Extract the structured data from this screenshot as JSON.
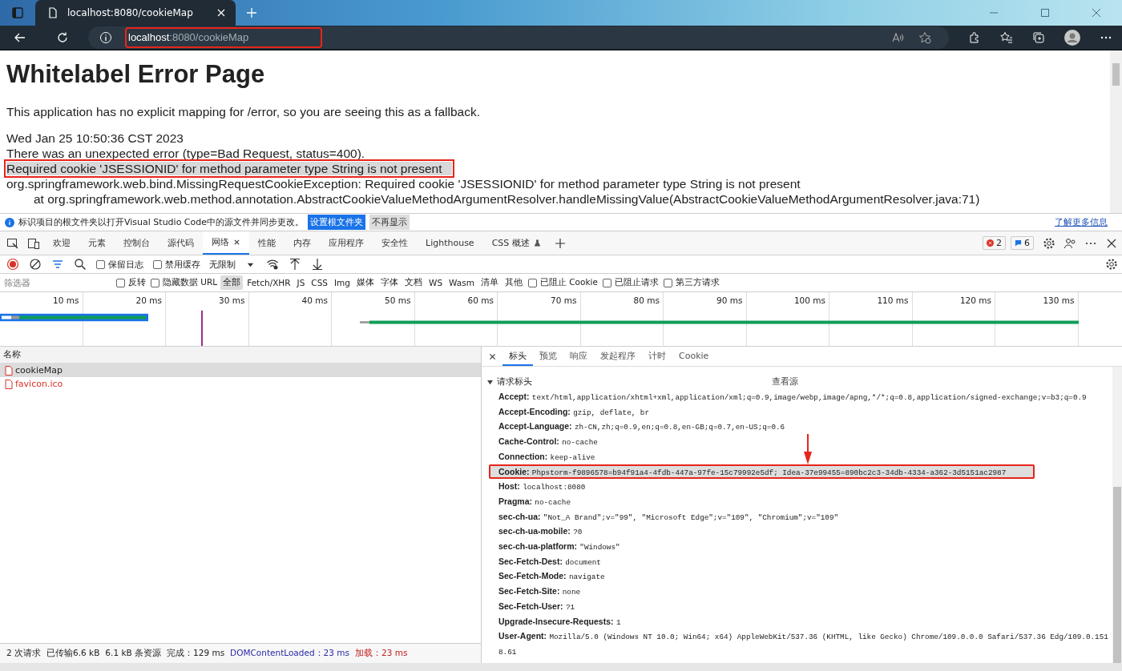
{
  "browser": {
    "tab_title": "localhost:8080/cookieMap",
    "address": {
      "host": "localhost",
      "path": ":8080/cookieMap",
      "highlighted": true
    }
  },
  "page": {
    "title": "Whitelabel Error Page",
    "intro": "This application has no explicit mapping for /error, so you are seeing this as a fallback.",
    "timestamp": "Wed Jan 25 10:50:36 CST 2023",
    "error": "There was an unexpected error (type=Bad Request, status=400).",
    "message": {
      "text": "Required cookie 'JSESSIONID' for method parameter type String is not present",
      "highlighted": true
    },
    "exception": "org.springframework.web.bind.MissingRequestCookieException: Required cookie 'JSESSIONID' for method parameter type String is not present",
    "trace": "at org.springframework.web.method.annotation.AbstractCookieValueMethodArgumentResolver.handleMissingValue(AbstractCookieValueMethodArgumentResolver.java:71)"
  },
  "infobar": {
    "text": "标识项目的根文件夹以打开Visual Studio Code中的源文件并同步更改。",
    "primary_button": "设置根文件夹",
    "secondary_button": "不再显示",
    "link": "了解更多信息"
  },
  "devtools": {
    "tabs": [
      {
        "label": "欢迎",
        "selected": false,
        "kind": "plain"
      },
      {
        "label": "元素",
        "selected": false,
        "kind": "plain"
      },
      {
        "label": "控制台",
        "selected": false,
        "kind": "plain"
      },
      {
        "label": "源代码",
        "selected": false,
        "kind": "plain"
      },
      {
        "label": "网络",
        "selected": true,
        "kind": "plain"
      },
      {
        "label": "性能",
        "selected": false,
        "kind": "plain"
      },
      {
        "label": "内存",
        "selected": false,
        "kind": "plain"
      },
      {
        "label": "应用程序",
        "selected": false,
        "kind": "plain"
      },
      {
        "label": "安全性",
        "selected": false,
        "kind": "plain"
      },
      {
        "label": "Lighthouse",
        "selected": false,
        "kind": "plain"
      },
      {
        "label": "CSS 概述",
        "selected": false,
        "kind": "experiment"
      }
    ],
    "error_count": "2",
    "message_count": "6",
    "toolbar": {
      "preserve_log": {
        "label": "保留日志",
        "checked": false
      },
      "disable_cache": {
        "label": "禁用缓存",
        "checked": false
      },
      "throttle": "无限制"
    },
    "filter": {
      "placeholder": "筛选器",
      "invert": {
        "label": "反转",
        "checked": false
      },
      "hide_data": {
        "label": "隐藏数据 URL",
        "checked": false
      },
      "types": [
        {
          "label": "全部",
          "selected": true
        },
        {
          "label": "Fetch/XHR",
          "selected": false
        },
        {
          "label": "JS",
          "selected": false
        },
        {
          "label": "CSS",
          "selected": false
        },
        {
          "label": "Img",
          "selected": false
        },
        {
          "label": "媒体",
          "selected": false
        },
        {
          "label": "字体",
          "selected": false
        },
        {
          "label": "文档",
          "selected": false
        },
        {
          "label": "WS",
          "selected": false
        },
        {
          "label": "Wasm",
          "selected": false
        },
        {
          "label": "清单",
          "selected": false
        },
        {
          "label": "其他",
          "selected": false
        }
      ],
      "options": [
        {
          "label": "已阻止 Cookie",
          "checked": false
        },
        {
          "label": "已阻止请求",
          "checked": false
        },
        {
          "label": "第三方请求",
          "checked": false
        }
      ]
    },
    "timeline": {
      "ticks": [
        "10 ms",
        "20 ms",
        "30 ms",
        "40 ms",
        "50 ms",
        "60 ms",
        "70 ms",
        "80 ms",
        "90 ms",
        "100 ms",
        "110 ms",
        "120 ms",
        "130 ms"
      ]
    },
    "requests": {
      "column": "名称",
      "rows": [
        {
          "name": "cookieMap",
          "selected": true
        },
        {
          "name": "favicon.ico",
          "selected": false
        }
      ]
    },
    "status": [
      {
        "text": "2 次请求",
        "kind": "plain"
      },
      {
        "text": "已传输6.6 kB",
        "kind": "plain"
      },
      {
        "text": "6.1 kB 条资源",
        "kind": "plain"
      },
      {
        "text": "完成：129 ms",
        "kind": "plain"
      },
      {
        "text": "DOMContentLoaded：23 ms",
        "kind": "dcl"
      },
      {
        "text": "加载：23 ms",
        "kind": "load"
      }
    ],
    "detail": {
      "tabs": [
        {
          "label": "标头",
          "selected": true
        },
        {
          "label": "预览",
          "selected": false
        },
        {
          "label": "响应",
          "selected": false
        },
        {
          "label": "发起程序",
          "selected": false
        },
        {
          "label": "计时",
          "selected": false
        },
        {
          "label": "Cookie",
          "selected": false
        }
      ],
      "section": {
        "title": "请求标头",
        "expanded": true,
        "action": "查看源"
      },
      "headers": [
        {
          "name": "Accept:",
          "value": "text/html,application/xhtml+xml,application/xml;q=0.9,image/webp,image/apng,*/*;q=0.8,application/signed-exchange;v=b3;q=0.9",
          "highlighted": false
        },
        {
          "name": "Accept-Encoding:",
          "value": "gzip, deflate, br",
          "highlighted": false
        },
        {
          "name": "Accept-Language:",
          "value": "zh-CN,zh;q=0.9,en;q=0.8,en-GB;q=0.7,en-US;q=0.6",
          "highlighted": false
        },
        {
          "name": "Cache-Control:",
          "value": "no-cache",
          "highlighted": false
        },
        {
          "name": "Connection:",
          "value": "keep-alive",
          "highlighted": false
        },
        {
          "name": "Cookie:",
          "value": "Phpstorm-f9896578=b94f91a4-4fdb-447a-97fe-15c79992e5df; Idea-37e99455=890bc2c3-34db-4334-a362-3d5151ac2987",
          "highlighted": true
        },
        {
          "name": "Host:",
          "value": "localhost:8080",
          "highlighted": false
        },
        {
          "name": "Pragma:",
          "value": "no-cache",
          "highlighted": false
        },
        {
          "name": "sec-ch-ua:",
          "value": "\"Not_A Brand\";v=\"99\", \"Microsoft Edge\";v=\"109\", \"Chromium\";v=\"109\"",
          "highlighted": false
        },
        {
          "name": "sec-ch-ua-mobile:",
          "value": "?0",
          "highlighted": false
        },
        {
          "name": "sec-ch-ua-platform:",
          "value": "\"Windows\"",
          "highlighted": false
        },
        {
          "name": "Sec-Fetch-Dest:",
          "value": "document",
          "highlighted": false
        },
        {
          "name": "Sec-Fetch-Mode:",
          "value": "navigate",
          "highlighted": false
        },
        {
          "name": "Sec-Fetch-Site:",
          "value": "none",
          "highlighted": false
        },
        {
          "name": "Sec-Fetch-User:",
          "value": "?1",
          "highlighted": false
        },
        {
          "name": "Upgrade-Insecure-Requests:",
          "value": "1",
          "highlighted": false
        },
        {
          "name": "User-Agent:",
          "value": "Mozilla/5.0 (Windows NT 10.0; Win64; x64) AppleWebKit/537.36 (KHTML, like Gecko) Chrome/109.0.0.0 Safari/537.36 Edg/109.0.1518.61",
          "highlighted": false
        }
      ]
    }
  }
}
